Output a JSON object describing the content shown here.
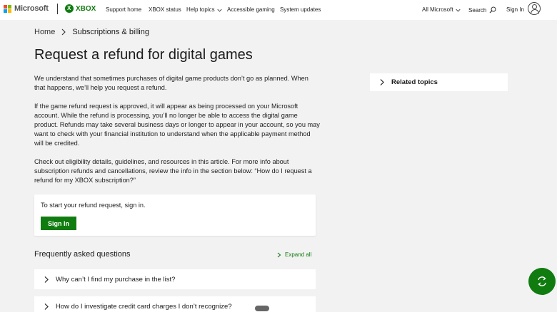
{
  "header": {
    "microsoft_label": "Microsoft",
    "xbox_label": "XBOX",
    "nav": [
      {
        "label": "Support home"
      },
      {
        "label": "XBOX status"
      },
      {
        "label": "Help topics"
      },
      {
        "label": "Accessible gaming"
      },
      {
        "label": "System updates"
      }
    ],
    "all_microsoft": "All Microsoft",
    "search": "Search",
    "sign_in": "Sign In"
  },
  "breadcrumb": {
    "home": "Home",
    "current": "Subscriptions & billing"
  },
  "article": {
    "title": "Request a refund for digital games",
    "paragraphs": [
      "We understand that sometimes purchases of digital game products don’t go as planned. When that happens, we’ll help you request a refund.",
      "If the game refund request is approved, it will appear as being processed on your Microsoft account. While the refund is processing, you’ll no longer be able to access the digital game product. Refunds may take several business days or longer to appear in your account, so you may want to check with your financial institution to understand when the applicable payment method will be credited.",
      "Check out eligibility details, guidelines, and resources in this article. For more info about subscription refunds and cancellations, review the info in the section below: “How do I request a refund for my XBOX subscription?”"
    ]
  },
  "signin_card": {
    "text": "To start your refund request, sign in.",
    "button": "Sign In"
  },
  "faq": {
    "title": "Frequently asked questions",
    "expand_all": "Expand all",
    "items": [
      {
        "label": "Why can’t I find my purchase in the list?"
      },
      {
        "label": "How do I investigate credit card charges I don’t recognize?"
      }
    ]
  },
  "sidebar": {
    "related_topics": "Related topics"
  },
  "colors": {
    "accent": "#107c10",
    "background": "#f2f2f2"
  },
  "icons": [
    "microsoft-logo-icon",
    "xbox-logo-icon",
    "chevron-down-icon",
    "search-icon",
    "avatar-icon",
    "chevron-right-icon",
    "feedback-icon"
  ]
}
